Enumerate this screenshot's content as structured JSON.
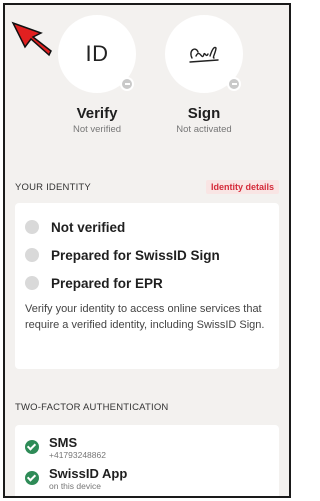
{
  "tiles": {
    "verify": {
      "icon_text": "ID",
      "title": "Verify",
      "status": "Not verified"
    },
    "sign": {
      "icon_text": "signature-glyph",
      "title": "Sign",
      "status": "Not activated"
    }
  },
  "identity": {
    "section_label": "YOUR IDENTITY",
    "details_link": "Identity details",
    "statuses": [
      {
        "label": "Not verified"
      },
      {
        "label": "Prepared for SwissID Sign"
      },
      {
        "label": "Prepared for EPR"
      }
    ],
    "description": "Verify your identity to access online services that require a verified identity, including SwissID Sign."
  },
  "twofa": {
    "section_label": "TWO-FACTOR AUTHENTICATION",
    "methods": [
      {
        "title": "SMS",
        "subtitle": "+41793248862"
      },
      {
        "title": "SwissID App",
        "subtitle": "on this device"
      }
    ]
  },
  "colors": {
    "accent": "#d42b3a",
    "success": "#2e8b57",
    "background": "#f3f1ef"
  }
}
